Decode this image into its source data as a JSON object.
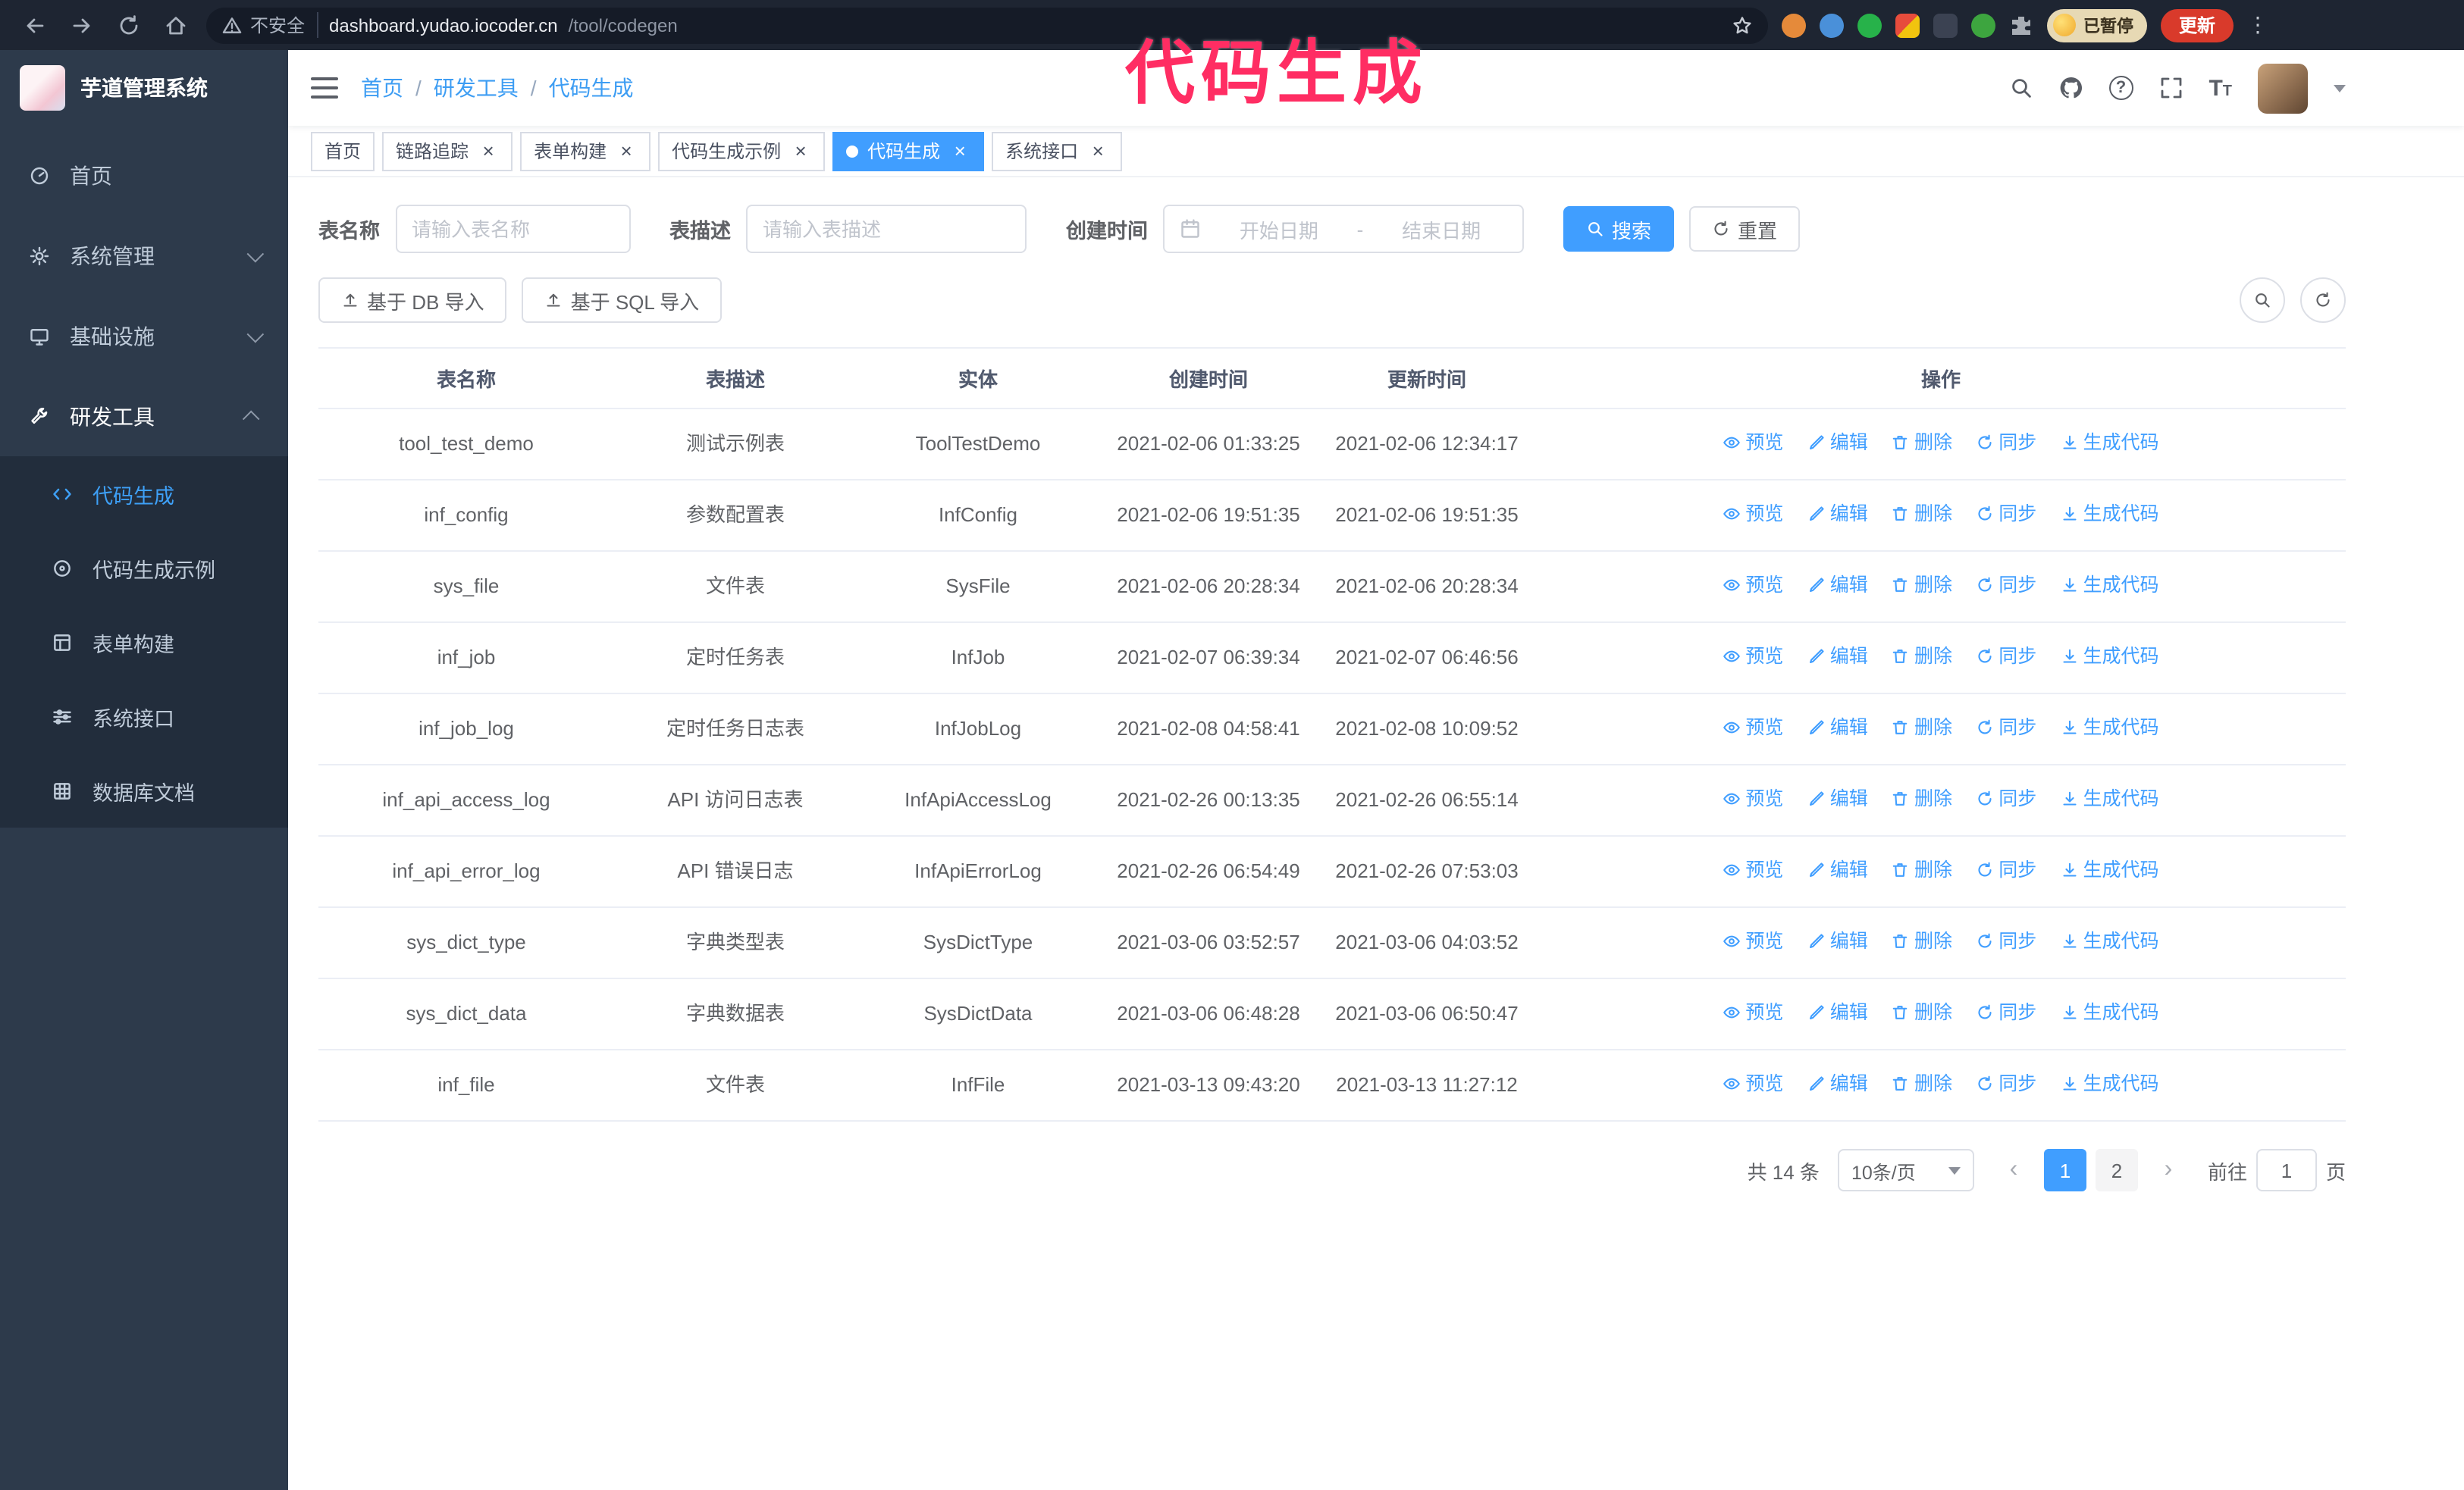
{
  "annotation": {
    "text": "代码生成"
  },
  "browser": {
    "security_label": "不安全",
    "url_domain": "dashboard.yudao.iocoder.cn",
    "url_path": "/tool/codegen",
    "profile_badge": "已暂停",
    "update_button": "更新"
  },
  "sidebar": {
    "logo_title": "芋道管理系统",
    "items": [
      {
        "label": "首页"
      },
      {
        "label": "系统管理"
      },
      {
        "label": "基础设施"
      },
      {
        "label": "研发工具"
      }
    ],
    "subitems": [
      {
        "label": "代码生成"
      },
      {
        "label": "代码生成示例"
      },
      {
        "label": "表单构建"
      },
      {
        "label": "系统接口"
      },
      {
        "label": "数据库文档"
      }
    ]
  },
  "breadcrumb": {
    "items": [
      "首页",
      "研发工具",
      "代码生成"
    ]
  },
  "tabs": [
    {
      "label": "首页"
    },
    {
      "label": "链路追踪"
    },
    {
      "label": "表单构建"
    },
    {
      "label": "代码生成示例"
    },
    {
      "label": "代码生成"
    },
    {
      "label": "系统接口"
    }
  ],
  "filters": {
    "table_name_label": "表名称",
    "table_name_placeholder": "请输入表名称",
    "table_desc_label": "表描述",
    "table_desc_placeholder": "请输入表描述",
    "create_time_label": "创建时间",
    "date_start_placeholder": "开始日期",
    "date_separator": "-",
    "date_end_placeholder": "结束日期",
    "search_button": "搜索",
    "reset_button": "重置"
  },
  "toolbar": {
    "import_db_button": "基于 DB 导入",
    "import_sql_button": "基于 SQL 导入"
  },
  "table": {
    "columns": [
      "表名称",
      "表描述",
      "实体",
      "创建时间",
      "更新时间",
      "操作"
    ],
    "actions": [
      "预览",
      "编辑",
      "删除",
      "同步",
      "生成代码"
    ],
    "rows": [
      {
        "name": "tool_test_demo",
        "desc": "测试示例表",
        "entity": "ToolTestDemo",
        "created": "2021-02-06 01:33:25",
        "updated": "2021-02-06 12:34:17"
      },
      {
        "name": "inf_config",
        "desc": "参数配置表",
        "entity": "InfConfig",
        "created": "2021-02-06 19:51:35",
        "updated": "2021-02-06 19:51:35"
      },
      {
        "name": "sys_file",
        "desc": "文件表",
        "entity": "SysFile",
        "created": "2021-02-06 20:28:34",
        "updated": "2021-02-06 20:28:34"
      },
      {
        "name": "inf_job",
        "desc": "定时任务表",
        "entity": "InfJob",
        "created": "2021-02-07 06:39:34",
        "updated": "2021-02-07 06:46:56"
      },
      {
        "name": "inf_job_log",
        "desc": "定时任务日志表",
        "entity": "InfJobLog",
        "created": "2021-02-08 04:58:41",
        "updated": "2021-02-08 10:09:52"
      },
      {
        "name": "inf_api_access_log",
        "desc": "API 访问日志表",
        "entity": "InfApiAccessLog",
        "created": "2021-02-26 00:13:35",
        "updated": "2021-02-26 06:55:14"
      },
      {
        "name": "inf_api_error_log",
        "desc": "API 错误日志",
        "entity": "InfApiErrorLog",
        "created": "2021-02-26 06:54:49",
        "updated": "2021-02-26 07:53:03"
      },
      {
        "name": "sys_dict_type",
        "desc": "字典类型表",
        "entity": "SysDictType",
        "created": "2021-03-06 03:52:57",
        "updated": "2021-03-06 04:03:52"
      },
      {
        "name": "sys_dict_data",
        "desc": "字典数据表",
        "entity": "SysDictData",
        "created": "2021-03-06 06:48:28",
        "updated": "2021-03-06 06:50:47"
      },
      {
        "name": "inf_file",
        "desc": "文件表",
        "entity": "InfFile",
        "created": "2021-03-13 09:43:20",
        "updated": "2021-03-13 11:27:12"
      }
    ]
  },
  "pagination": {
    "total": "共 14 条",
    "page_size": "10条/页",
    "pages": [
      "1",
      "2"
    ],
    "goto_label": "前往",
    "goto_value": "1",
    "goto_unit": "页"
  },
  "colors": {
    "primary": "#409eff",
    "sidebar_bg": "#2d3a4b",
    "annotation_pink": "#ff2d63"
  }
}
